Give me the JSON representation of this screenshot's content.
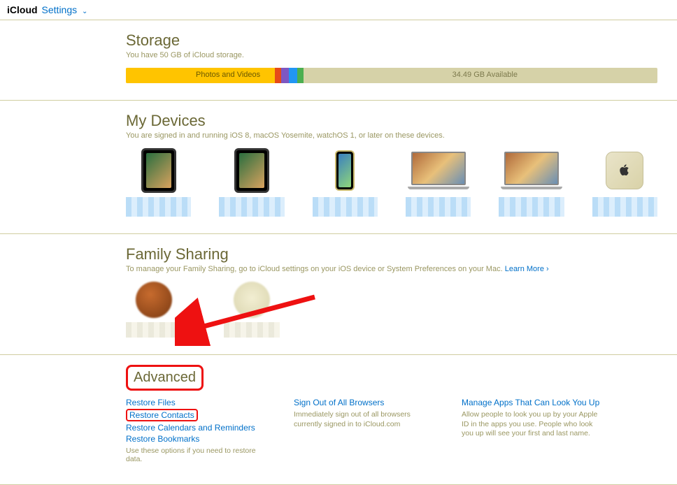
{
  "header": {
    "brand": "iCloud",
    "settings": "Settings"
  },
  "storage": {
    "title": "Storage",
    "subtitle": "You have 50 GB of iCloud storage.",
    "photos_label": "Photos and Videos",
    "available_label": "34.49 GB Available"
  },
  "devices": {
    "title": "My Devices",
    "subtitle": "You are signed in and running iOS 8, macOS Yosemite, watchOS 1, or later on these devices."
  },
  "family": {
    "title": "Family Sharing",
    "subtitle_before": "To manage your Family Sharing, go to iCloud settings on your iOS device or System Preferences on your Mac. ",
    "learn_more": "Learn More"
  },
  "advanced": {
    "title": "Advanced",
    "restore": {
      "files": "Restore Files",
      "contacts": "Restore Contacts",
      "cal": "Restore Calendars and Reminders",
      "bookmarks": "Restore Bookmarks",
      "note": "Use these options if you need to restore data."
    },
    "signout": {
      "label": "Sign Out of All Browsers",
      "desc": "Immediately sign out of all browsers currently signed in to iCloud.com"
    },
    "manage": {
      "label": "Manage Apps That Can Look You Up",
      "desc": "Allow people to look you up by your Apple ID in the apps you use. People who look you up will see your first and last name."
    }
  }
}
